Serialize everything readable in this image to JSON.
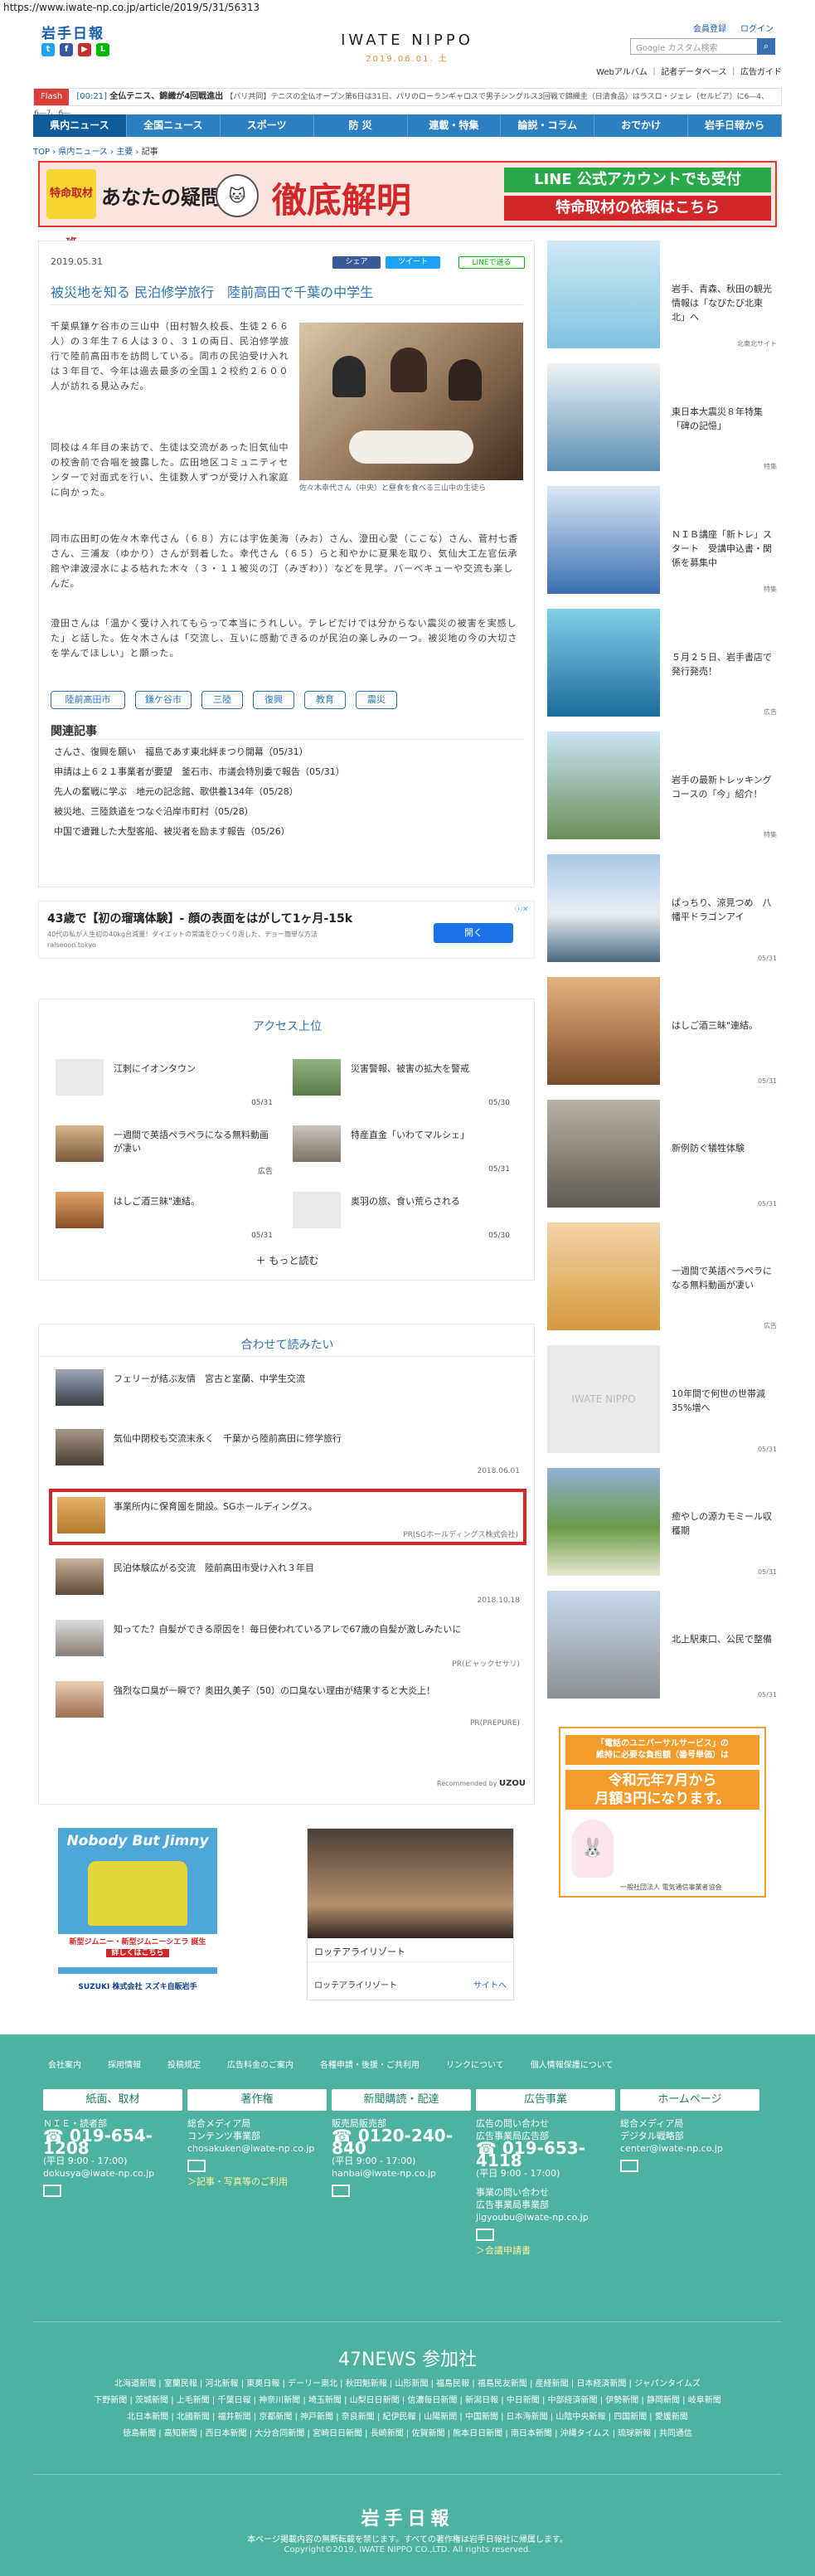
{
  "url": "https://www.iwate-np.co.jp/article/2019/5/31/56313",
  "header": {
    "logo_ja": "岩手日報",
    "masthead": "IWATE NIPPO",
    "date": "2019.06.01. 土",
    "member_register": "会員登録",
    "login": "ログイン",
    "search_placeholder": "Google カスタム検索",
    "subnav": [
      "Webアルバム",
      "記者データベース",
      "広告ガイド"
    ]
  },
  "flash": {
    "label": "Flash",
    "time": "[00:21]",
    "text1": "全仏テニス、錦織が4回戦進出",
    "text2": "【パリ共同】テニスの全仏オープン第6日は31日、パリのローランギャロスで男子シングルス3回戦で錦織圭（日清食品）はラスロ・ジェレ（セルビア）に6―4、6―7、6―..."
  },
  "nav": [
    "県内ニュース",
    "全国ニュース",
    "スポーツ",
    "防 災",
    "連載・特集",
    "論説・コラム",
    "おでかけ",
    "岩手日報から"
  ],
  "breadcrumb": [
    "TOP",
    "県内ニュース",
    "主要",
    "記事"
  ],
  "banner": {
    "tag": "特命取材班",
    "text_left": "あなたの疑問",
    "text_mid": "徹底解明",
    "line1": "LINE 公式アカウントでも受付",
    "line2": "特命取材の依頼はこちら"
  },
  "article": {
    "date": "2019.05.31",
    "share_fb": "シェア",
    "share_tw": "ツイート",
    "share_line": "LINEで送る",
    "title": "被災地を知る 民泊修学旅行　陸前高田で千葉の中学生",
    "p1": "千葉県鎌ケ谷市の三山中（田村智久校長、生徒２６６人）の３年生７６人は３０、３１の両日、民泊修学旅行で陸前高田市を訪問している。同市の民泊受け入れは３年目で、今年は過去最多の全国１２校約２６００人が訪れる見込みだ。",
    "p2": "同校は４年目の来訪で、生徒は交流があった旧気仙中の校舎前で合唱を披露した。広田地区コミュニティセンターで対面式を行い、生徒数人ずつが受け入れ家庭に向かった。",
    "p3": "同市広田町の佐々木幸代さん（６８）方には宇佐美海（みお）さん、澄田心愛（ここな）さん、菅村七香さん、三浦友（ゆかり）さんが到着した。幸代さん（６５）らと和やかに夏果を取り、気仙大工左官伝承館や津波浸水による枯れた木々（３・１１被災の汀（みぎわ））などを見学。バーベキューや交流も楽しんだ。",
    "p4": "澄田さんは「温かく受け入れてもらって本当にうれしい。テレビだけでは分からない震災の被害を実感した」と話した。佐々木さんは「交流し、互いに感動できるのが民泊の楽しみの一つ。被災地の今の大切さを学んでほしい」と願った。",
    "caption": "佐々木幸代さん（中央）と昼食を食べる三山中の生徒ら",
    "tags": [
      "陸前高田市",
      "鎌ケ谷市",
      "三陸",
      "復興",
      "教育",
      "震災"
    ],
    "related_title": "関連記事",
    "related": [
      "さんさ、復興を願い　福島であす東北絆まつり開幕（05/31）",
      "申請は上６２１事業者が要望　釜石市、市議会特別委で報告（05/31）",
      "先人の奮戦に学ぶ　地元の記念館、歌供養134年（05/28）",
      "被災地、三陸鉄道をつなぐ沿岸市町村（05/28）",
      "中国で遭難した大型客船、被災者を励ます報告（05/26）"
    ]
  },
  "ad_strip": {
    "title": "43歳で【初の瑠璃体験】- 顔の表面をはがして1ヶ月-15k",
    "desc": "40代の私が人生初の40kg台減量！ダイエットの常識をひっくり返した、チョー簡単な方法",
    "source": "raiseoon.tokyo",
    "cta": "開く"
  },
  "access": {
    "title": "アクセス上位",
    "items": [
      {
        "title": "江刺にイオンタウン",
        "date": "05/31"
      },
      {
        "title": "災害警報、被害の拡大を警戒",
        "date": "05/30"
      },
      {
        "title": "一週間で英語ペラペラになる無料動画が凄い",
        "date": "広告"
      },
      {
        "title": "特産直金「いわてマルシェ」",
        "date": "05/31"
      },
      {
        "title": "はしご酒三昧\"連結。",
        "date": "05/31"
      },
      {
        "title": "奥羽の旅、食い荒らされる",
        "date": "05/30"
      }
    ],
    "more": "もっと読む"
  },
  "recommend": {
    "title": "合わせて読みたい",
    "items": [
      {
        "title": "フェリーが結ぶ友情　宮古と室蘭、中学生交流",
        "meta": ""
      },
      {
        "title": "気仙中閉校も交流末永く　千葉から陸前高田に修学旅行",
        "meta": "2018.06.01"
      },
      {
        "title": "事業所内に保育園を開設。SGホールディングス。",
        "meta": "PR(SGホールディングス株式会社)"
      },
      {
        "title": "民泊体験広がる交流　陸前高田市受け入れ３年目",
        "meta": "2018.10.18"
      },
      {
        "title": "知ってた？自髪ができる原因を！毎日使われているアレで67歳の自髪が激しみたいに",
        "meta": "PR(ビャックセサリ)"
      },
      {
        "title": "強烈な口臭が一瞬で？奥田久美子（50）の口臭ない理由が結果すると大炎上！",
        "meta": "PR(PREPURE)"
      }
    ],
    "powered": "Recommended by"
  },
  "bottom_ads": {
    "left_top": "Nobody But Jimny",
    "left_mid": "新型ジムニー・新型ジムニーシエラ 誕生",
    "left_cta": "詳しくはこちら",
    "left_brand": "SUZUKI 株式会社 スズキ自販岩手",
    "right_caption": "ロッテアライリゾート",
    "right_brand": "ロッテアライリゾート",
    "right_link": "サイトへ"
  },
  "sidebar": [
    {
      "text": "岩手、青森、秋田の観光情報は「なびたび北東北」へ",
      "src": "北東北サイト"
    },
    {
      "text": "東日本大震災８年特集「碑の記憶」",
      "src": "特集"
    },
    {
      "text": "ＮＩＢ講座「新トレ」スタート　受講申込書・関係を募集中",
      "src": "特集"
    },
    {
      "text": "５月２５日、岩手書店で発行発売！",
      "src": "広告"
    },
    {
      "text": "岩手の最新トレッキングコースの「今」紹介！",
      "src": "特集"
    },
    {
      "text": "ぱっちり、涼見つめ　八幡平ドラゴンアイ",
      "src": "05/31"
    },
    {
      "text": "はしご酒三昧\"連結。",
      "src": "05/31"
    },
    {
      "text": "新例防ぐ犠牲体験",
      "src": "05/31"
    },
    {
      "text": "一週間で英語ペラペラになる無料動画が凄い",
      "src": "広告"
    },
    {
      "text": "10年間で何世の世帯減35%増へ",
      "src": "05/31"
    },
    {
      "text": "癒やしの源カモミール収穫期",
      "src": "05/31"
    },
    {
      "text": "北上駅東口、公民で整備",
      "src": "05/31"
    }
  ],
  "sidebar_banner": {
    "line1": "「電話のユニバーサルサービス」の",
    "line2": "維持に必要な負担額（番号単価）は",
    "line3": "令和元年7月から",
    "line4": "月額3円になります。",
    "footnote": "一般社団法人 電気通信事業者協会"
  },
  "footer": {
    "links": [
      "会社案内",
      "採用情報",
      "投稿規定",
      "広告料金のご案内",
      "各種申請・後援・ご共利用",
      "リンクについて",
      "個人情報保護について"
    ],
    "cols": [
      {
        "head": "紙面、取材",
        "l1": "ＮＩＥ・読者部",
        "tel": "019-654-1208",
        "hours": "(平日 9:00 - 17:00)",
        "mail": "dokusya@iwate-np.co.jp",
        "extra": ""
      },
      {
        "head": "著作権",
        "l1": "総合メディア局",
        "l2": "コンテンツ事業部",
        "tel": "",
        "hours": "",
        "mail": "chosakuken@iwate-np.co.jp",
        "extra": "＞記事・写真等のご利用"
      },
      {
        "head": "新聞購読・配達",
        "l1": "販売局販売部",
        "tel": "0120-240-840",
        "hours": "(平日 9:00 - 17:00)",
        "mail": "hanbai@iwate-np.co.jp",
        "extra": ""
      },
      {
        "head": "広告事業",
        "l1": "広告の問い合わせ",
        "l2": "広告事業局広告部",
        "tel": "019-653-4118",
        "hours": "(平日 9:00 - 17:00)",
        "l3": "事業の問い合わせ",
        "l4": "広告事業局事業部",
        "mail": "jigyoubu@iwate-np.co.jp",
        "extra": "＞会議申請書"
      },
      {
        "head": "ホームページ",
        "l1": "総合メディア局",
        "l2": "デジタル戦略部",
        "tel": "",
        "hours": "",
        "mail": "center@iwate-np.co.jp",
        "extra": ""
      }
    ],
    "news47": "47NEWS 参加社",
    "members1": "北海道新聞 | 室蘭民報 | 河北新報 | 東奥日報 | デーリー東北 | 秋田魁新報 | 山形新聞 | 福島民報 | 福島民友新聞 | 産経新聞 | 日本経済新聞 | ジャパンタイムズ",
    "members2": "下野新聞 | 茨城新聞 | 上毛新聞 | 千葉日報 | 神奈川新聞 | 埼玉新聞 | 山梨日日新聞 | 信濃毎日新聞 | 新潟日報 | 中日新聞 | 中部経済新聞 | 伊勢新聞 | 静岡新聞 | 岐阜新聞",
    "members3": "北日本新聞 | 北國新聞 | 福井新聞 | 京都新聞 | 神戸新聞 | 奈良新聞 | 紀伊民報 | 山陽新聞 | 中国新聞 | 日本海新聞 | 山陰中央新報 | 四国新聞 | 愛媛新聞",
    "members4": "徳島新聞 | 高知新聞 | 西日本新聞 | 大分合同新聞 | 宮崎日日新聞 | 長崎新聞 | 佐賀新聞 | 熊本日日新聞 | 南日本新聞 | 沖縄タイムス | 琉球新報 | 共同通信",
    "logo": "岩手日報",
    "notice": "本ページ掲載内容の無断転載を禁じます。すべての著作権は岩手日報社に帰属します。",
    "copyright": "Copyright©2019, IWATE NIPPO CO.,LTD. All rights reserved."
  }
}
